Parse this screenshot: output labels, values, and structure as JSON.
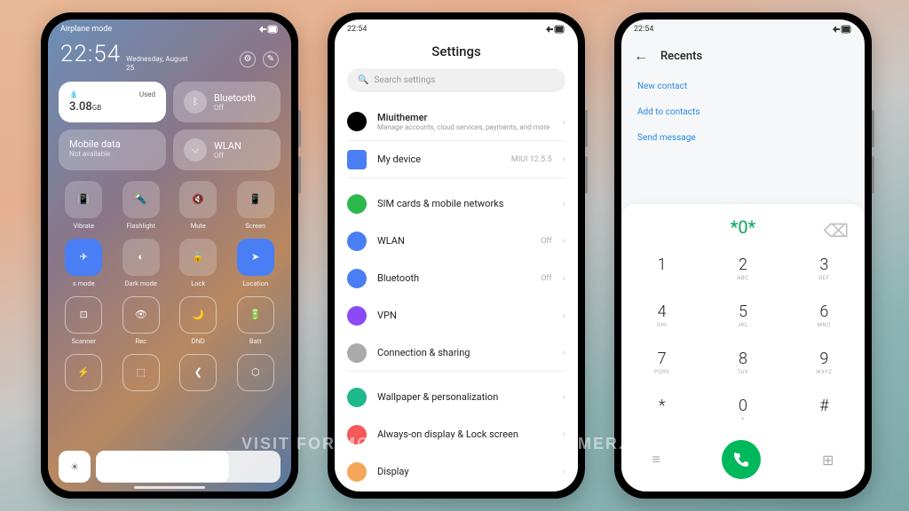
{
  "cc": {
    "status": "Airplane mode",
    "time": "22:54",
    "date_day": "Wednesday, August",
    "date_num": "25",
    "cleaner_label": "Used",
    "cleaner_val": "3.08",
    "cleaner_unit": "GB",
    "bt_label": "Bluetooth",
    "bt_status": "Off",
    "data_label": "Mobile data",
    "data_status": "Not available",
    "wlan_label": "WLAN",
    "wlan_status": "Off",
    "tiles": [
      {
        "label": "Vibrate"
      },
      {
        "label": "Flashlight"
      },
      {
        "label": "Mute"
      },
      {
        "label": "Screen"
      },
      {
        "label": "s mode"
      },
      {
        "label": "Dark mode"
      },
      {
        "label": "Lock"
      },
      {
        "label": "Location"
      },
      {
        "label": "Scanner"
      },
      {
        "label": "Rec"
      },
      {
        "label": "DND"
      },
      {
        "label": "Batt"
      }
    ]
  },
  "settings": {
    "time": "22:54",
    "title": "Settings",
    "search": "Search settings",
    "profile_name": "Miuithemer",
    "profile_sub": "Manage accounts, cloud services, payments, and more",
    "items": [
      {
        "label": "My device",
        "val": "MIUI 12.5.5"
      },
      {
        "label": "SIM cards & mobile networks",
        "val": ""
      },
      {
        "label": "WLAN",
        "val": "Off"
      },
      {
        "label": "Bluetooth",
        "val": "Off"
      },
      {
        "label": "VPN",
        "val": ""
      },
      {
        "label": "Connection & sharing",
        "val": ""
      },
      {
        "label": "Wallpaper & personalization",
        "val": ""
      },
      {
        "label": "Always-on display & Lock screen",
        "val": ""
      },
      {
        "label": "Display",
        "val": ""
      }
    ]
  },
  "dialer": {
    "time": "22:54",
    "title": "Recents",
    "actions": [
      "New contact",
      "Add to contacts",
      "Send message"
    ],
    "input": "*0*",
    "keys": [
      {
        "n": "1",
        "l": ""
      },
      {
        "n": "2",
        "l": "ABC"
      },
      {
        "n": "3",
        "l": "DEF"
      },
      {
        "n": "4",
        "l": "GHI"
      },
      {
        "n": "5",
        "l": "JKL"
      },
      {
        "n": "6",
        "l": "MNO"
      },
      {
        "n": "7",
        "l": "PQRS"
      },
      {
        "n": "8",
        "l": "TUV"
      },
      {
        "n": "9",
        "l": "WXYZ"
      },
      {
        "n": "*",
        "l": ""
      },
      {
        "n": "0",
        "l": "+"
      },
      {
        "n": "#",
        "l": ""
      }
    ]
  },
  "watermark": "VISIT FOR MORE THEMES - MIUITHEMER.COM"
}
